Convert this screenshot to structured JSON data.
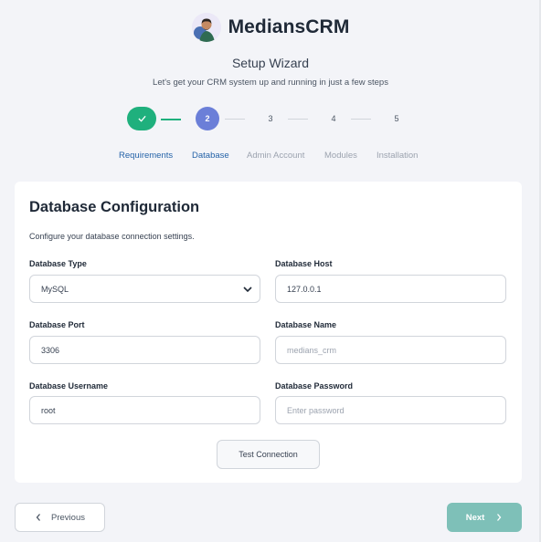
{
  "brand": {
    "name": "MediansCRM"
  },
  "wizard": {
    "title": "Setup Wizard",
    "subtitle": "Let's get your CRM system up and running in just a few steps"
  },
  "steps": [
    {
      "number": "",
      "label": "Requirements",
      "state": "done"
    },
    {
      "number": "2",
      "label": "Database",
      "state": "active"
    },
    {
      "number": "3",
      "label": "Admin Account",
      "state": "pending"
    },
    {
      "number": "4",
      "label": "Modules",
      "state": "pending"
    },
    {
      "number": "5",
      "label": "Installation",
      "state": "pending"
    }
  ],
  "card": {
    "title": "Database Configuration",
    "description": "Configure your database connection settings.",
    "fields": {
      "db_type": {
        "label": "Database Type",
        "value": "MySQL"
      },
      "db_host": {
        "label": "Database Host",
        "value": "127.0.0.1"
      },
      "db_port": {
        "label": "Database Port",
        "value": "3306"
      },
      "db_name": {
        "label": "Database Name",
        "value": "",
        "placeholder": "medians_crm"
      },
      "db_user": {
        "label": "Database Username",
        "value": "root"
      },
      "db_pass": {
        "label": "Database Password",
        "value": "",
        "placeholder": "Enter password"
      }
    },
    "test_button": "Test Connection"
  },
  "nav": {
    "previous": "Previous",
    "next": "Next"
  },
  "colors": {
    "success": "#1fb07d",
    "active": "#6b7fd8",
    "next_button": "#7ec0b8",
    "link": "#2563a8"
  }
}
